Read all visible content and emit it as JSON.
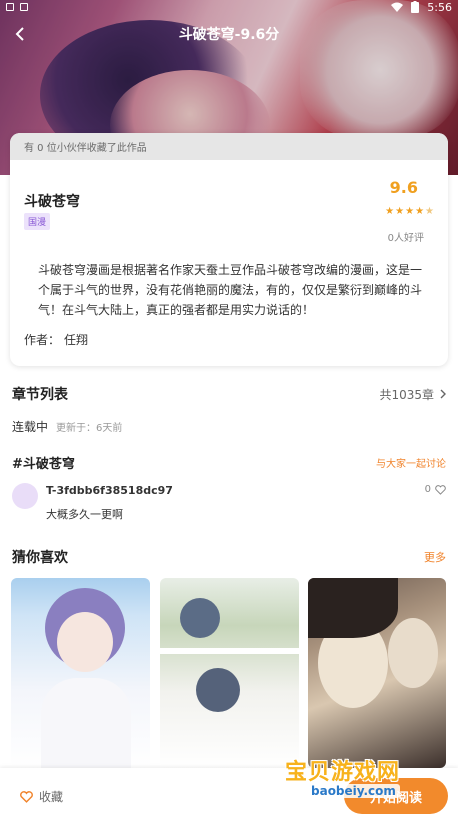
{
  "status": {
    "time": "5:56"
  },
  "header": {
    "title": "斗破苍穹-9.6分"
  },
  "card": {
    "fav_text": "有 0 位小伙伴收藏了此作品",
    "name": "斗破苍穹",
    "tag": "国漫",
    "score": "9.6",
    "rating_stars": 4.5,
    "praise": "0人好评",
    "description": "斗破苍穹漫画是根据著名作家天蚕土豆作品斗破苍穹改编的漫画，这是一个属于斗气的世界，没有花俏艳丽的魔法，有的，仅仅是繁衍到巅峰的斗气！在斗气大陆上，真正的强者都是用实力说话的！",
    "author_label": "作者：",
    "author": "任翔"
  },
  "chapters": {
    "title": "章节列表",
    "total": "共1035章",
    "serial_status": "连载中",
    "updated": "更新于：6天前"
  },
  "topic": {
    "title": "#斗破苍穹",
    "discuss": "与大家一起讨论"
  },
  "comment": {
    "user": "T-3fdbb6f38518dc97",
    "text": "大概多久一更啊",
    "likes": "0"
  },
  "recommend": {
    "title": "猜你喜欢",
    "more": "更多"
  },
  "bottom": {
    "collect": "收藏",
    "read": "开始阅读"
  },
  "watermark": {
    "title": "宝贝游戏网",
    "url": "baobeiy.com"
  },
  "colors": {
    "accent": "#f28a2c",
    "score": "#f0a020",
    "tag": "#8a5ad6"
  }
}
